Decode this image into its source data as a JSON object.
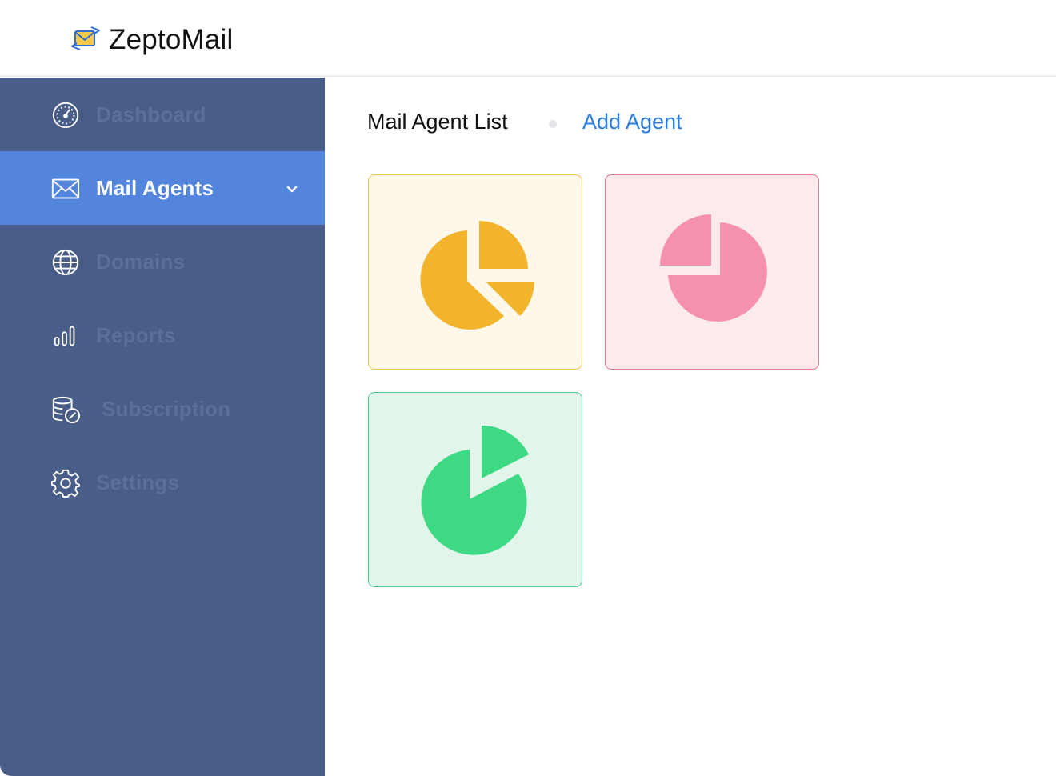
{
  "app": {
    "name": "ZeptoMail",
    "logo_icon": "zeptomail-envelope-icon"
  },
  "sidebar": {
    "items": [
      {
        "label": "Dashboard",
        "icon": "dashboard-gauge-icon",
        "active": false
      },
      {
        "label": "Mail Agents",
        "icon": "envelope-icon",
        "active": true,
        "expand_icon": "chevron-down-icon"
      },
      {
        "label": "Domains",
        "icon": "globe-icon",
        "active": false
      },
      {
        "label": "Reports",
        "icon": "bar-chart-icon",
        "active": false
      },
      {
        "label": "Subscription",
        "icon": "subscription-coins-icon",
        "active": false
      },
      {
        "label": "Settings",
        "icon": "gear-icon",
        "active": false
      }
    ]
  },
  "main": {
    "title": "Mail Agent List",
    "add_agent_label": "Add Agent",
    "agents": [
      {
        "icon": "pie-chart-icon",
        "color": "#f2b42c",
        "bg": "#fdf8ea",
        "border": "#ecc353"
      },
      {
        "icon": "pie-chart-icon",
        "color": "#f590ae",
        "bg": "#fcebed",
        "border": "#e57592"
      },
      {
        "icon": "pie-chart-icon",
        "color": "#3fd985",
        "bg": "#e1f5ea",
        "border": "#4fcb92"
      }
    ]
  },
  "colors": {
    "sidebar_bg": "#485d87",
    "active_item_bg": "#5485dc",
    "link": "#2a7ce0"
  }
}
